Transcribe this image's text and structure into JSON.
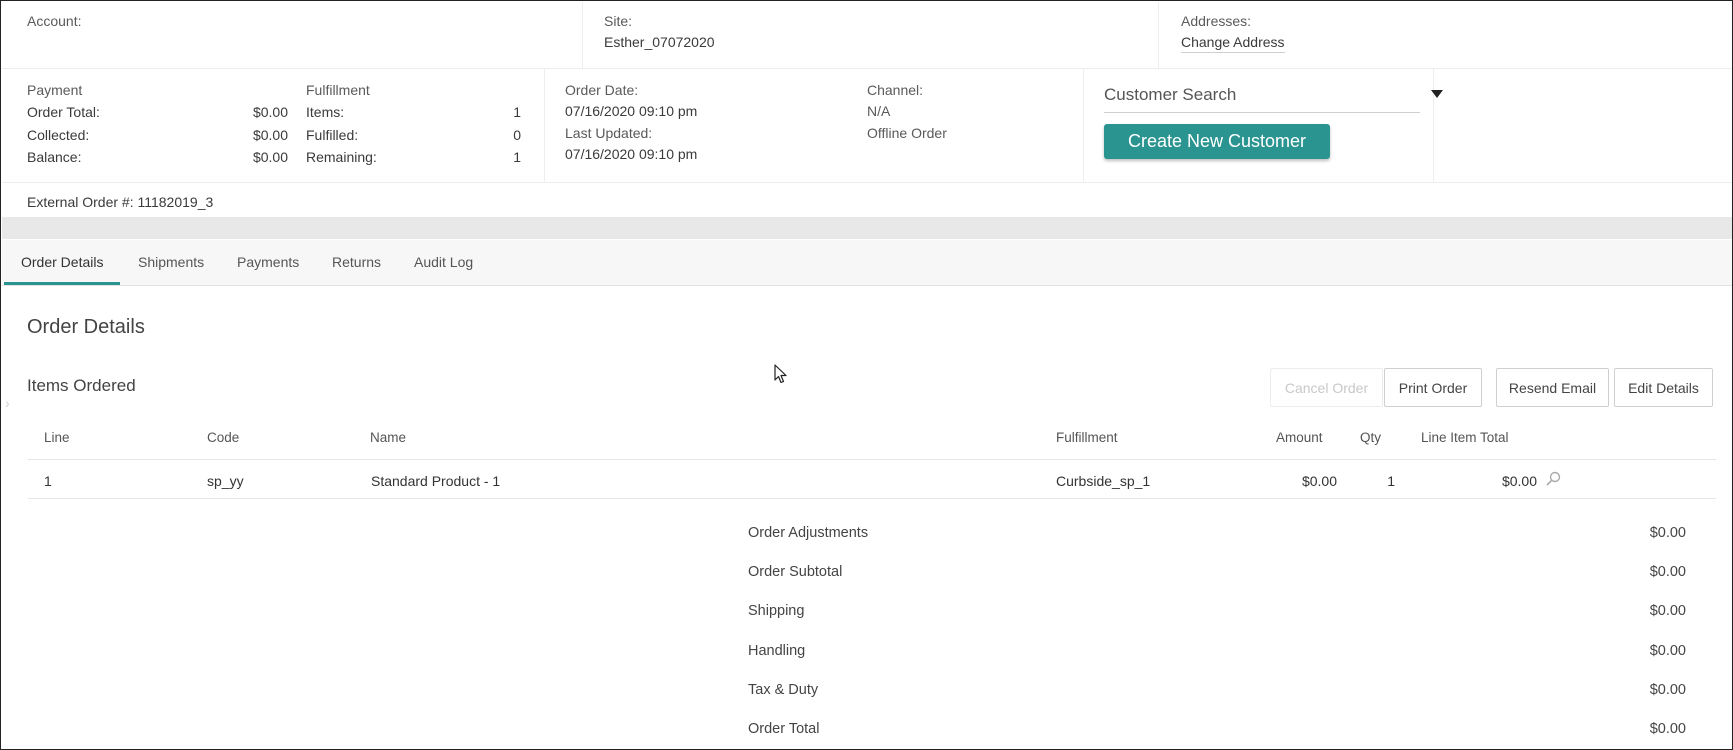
{
  "header": {
    "account_label": "Account:",
    "site_label": "Site:",
    "site_value": "Esther_07072020",
    "addresses_label": "Addresses:",
    "change_address_link": "Change Address"
  },
  "payment": {
    "title": "Payment",
    "rows": [
      {
        "label": "Order Total:",
        "value": "$0.00"
      },
      {
        "label": "Collected:",
        "value": "$0.00"
      },
      {
        "label": "Balance:",
        "value": "$0.00"
      }
    ]
  },
  "fulfillment": {
    "title": "Fulfillment",
    "rows": [
      {
        "label": "Items:",
        "value": "1"
      },
      {
        "label": "Fulfilled:",
        "value": "0"
      },
      {
        "label": "Remaining:",
        "value": "1"
      }
    ]
  },
  "dates": {
    "order_date_label": "Order Date:",
    "order_date_value": "07/16/2020 09:10 pm",
    "last_updated_label": "Last Updated:",
    "last_updated_value": "07/16/2020 09:10 pm"
  },
  "channel": {
    "label": "Channel:",
    "value": "N/A",
    "type": "Offline Order"
  },
  "customer": {
    "search_placeholder": "Customer Search",
    "create_button": "Create New Customer"
  },
  "external_order": "External Order #: 11182019_3",
  "tabs": [
    {
      "label": "Order Details",
      "active": true
    },
    {
      "label": "Shipments",
      "active": false
    },
    {
      "label": "Payments",
      "active": false
    },
    {
      "label": "Returns",
      "active": false
    },
    {
      "label": "Audit Log",
      "active": false
    }
  ],
  "main": {
    "section_title": "Order Details",
    "items_title": "Items Ordered",
    "buttons": {
      "cancel": "Cancel Order",
      "print": "Print Order",
      "resend": "Resend Email",
      "edit": "Edit Details"
    }
  },
  "table": {
    "columns": [
      "Line",
      "Code",
      "Name",
      "Fulfillment",
      "Amount",
      "Qty",
      "Line Item Total"
    ],
    "rows": [
      {
        "line": "1",
        "code": "sp_yy",
        "name": "Standard Product - 1",
        "fulfillment": "Curbside_sp_1",
        "amount": "$0.00",
        "qty": "1",
        "total": "$0.00"
      }
    ]
  },
  "summary": [
    {
      "label": "Order Adjustments",
      "value": "$0.00"
    },
    {
      "label": "Order Subtotal",
      "value": "$0.00"
    },
    {
      "label": "Shipping",
      "value": "$0.00"
    },
    {
      "label": "Handling",
      "value": "$0.00"
    },
    {
      "label": "Tax & Duty",
      "value": "$0.00"
    },
    {
      "label": "Order Total",
      "value": "$0.00"
    }
  ],
  "colors": {
    "accent": "#2a9490",
    "band": "#e8e8e8"
  }
}
